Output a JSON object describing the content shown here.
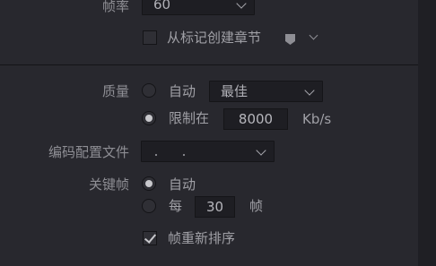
{
  "frame_rate": {
    "label": "帧率",
    "value": "60"
  },
  "chapters_from_markers": {
    "label": "从标记创建章节",
    "checked": false
  },
  "quality": {
    "label": "质量",
    "auto_label": "自动",
    "auto_selected": false,
    "quality_value": "最佳",
    "limit_label": "限制在",
    "limit_selected": true,
    "limit_value": "8000",
    "limit_unit": "Kb/s"
  },
  "encoding_profile": {
    "label": "编码配置文件",
    "value": ""
  },
  "keyframes": {
    "label": "关键帧",
    "auto_label": "自动",
    "auto_selected": true,
    "every_label": "每",
    "every_selected": false,
    "every_value": "30",
    "every_unit": "帧"
  },
  "frame_reorder": {
    "label": "帧重新排序",
    "checked": true
  }
}
